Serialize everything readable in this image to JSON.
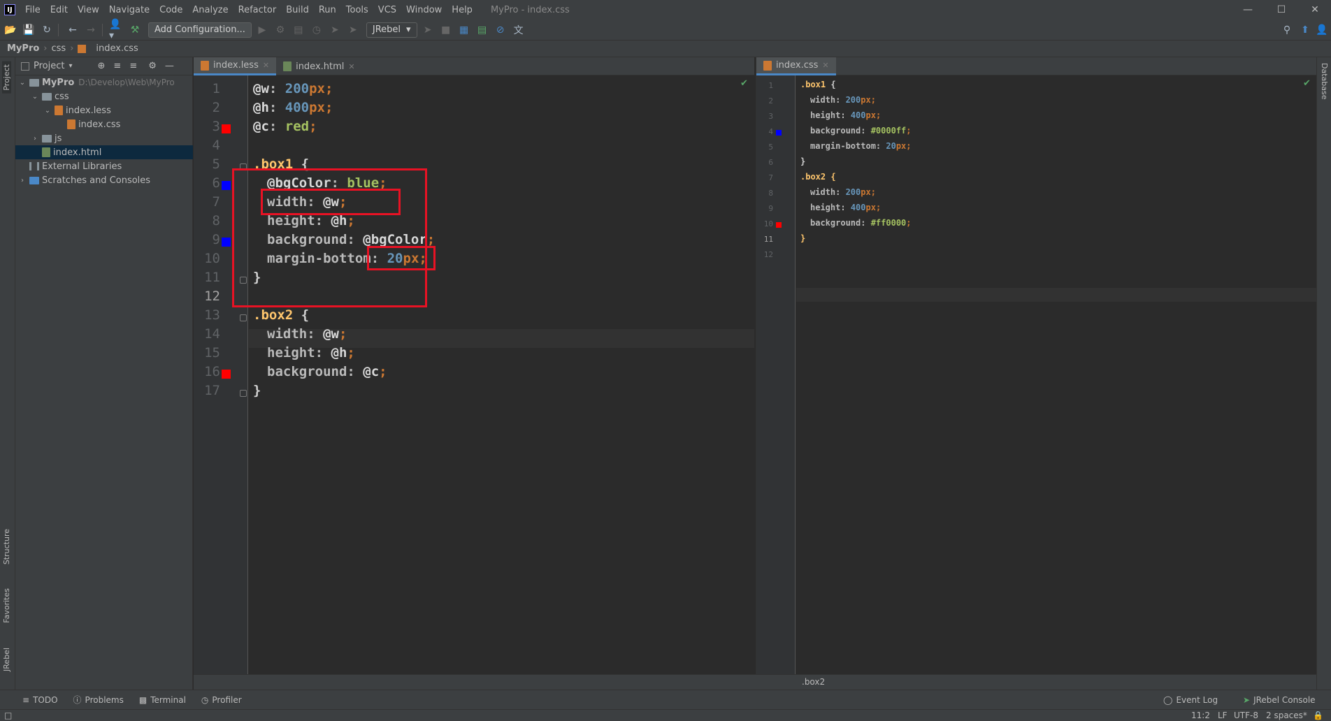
{
  "titlebar": {
    "menu": [
      "File",
      "Edit",
      "View",
      "Navigate",
      "Code",
      "Analyze",
      "Refactor",
      "Build",
      "Run",
      "Tools",
      "VCS",
      "Window",
      "Help"
    ],
    "title": "MyPro - index.css"
  },
  "toolbar": {
    "add_config_label": "Add Configuration...",
    "jrebel_label": "JRebel"
  },
  "breadcrumb": {
    "items": [
      "MyPro",
      "css",
      "index.css"
    ]
  },
  "project_panel": {
    "header": "Project",
    "tree": [
      {
        "label": "MyPro",
        "path": "D:\\Develop\\Web\\MyPro"
      },
      {
        "label": "css"
      },
      {
        "label": "index.less"
      },
      {
        "label": "index.css"
      },
      {
        "label": "js"
      },
      {
        "label": "index.html"
      },
      {
        "label": "External Libraries"
      },
      {
        "label": "Scratches and Consoles"
      }
    ]
  },
  "left_strip": {
    "tabs": [
      "Project",
      "Structure",
      "Favorites",
      "JRebel"
    ]
  },
  "right_strip": {
    "tabs": [
      "Database"
    ]
  },
  "editor_left": {
    "tabs": [
      "index.less",
      "index.html"
    ],
    "line_numbers": [
      "1",
      "2",
      "3",
      "4",
      "5",
      "6",
      "7",
      "8",
      "9",
      "10",
      "11",
      "12",
      "13",
      "14",
      "15",
      "16",
      "17"
    ],
    "swatch_colors": {
      "red": "#ff0000",
      "blue": "#0000ff"
    }
  },
  "editor_right": {
    "tabs": [
      "index.css"
    ],
    "line_numbers": [
      "1",
      "2",
      "3",
      "4",
      "5",
      "6",
      "7",
      "8",
      "9",
      "10",
      "11",
      "12"
    ]
  },
  "less_code": {
    "l1": {
      "var": "@w",
      "colon": ": ",
      "num": "200",
      "unit": "px",
      "semi": ";"
    },
    "l2": {
      "var": "@h",
      "colon": ": ",
      "num": "400",
      "unit": "px",
      "semi": ";"
    },
    "l3": {
      "var": "@c",
      "colon": ": ",
      "val": "red",
      "semi": ";"
    },
    "l5": {
      "sel": ".box1",
      "brace": " {"
    },
    "l6": {
      "var": "@bgColor",
      "colon": ": ",
      "val": "blue",
      "semi": ";"
    },
    "l7": {
      "prop": "width",
      "colon": ": ",
      "ref": "@w",
      "semi": ";"
    },
    "l8": {
      "prop": "height",
      "colon": ": ",
      "ref": "@h",
      "semi": ";"
    },
    "l9": {
      "prop": "background",
      "colon": ": ",
      "ref": "@bgColor",
      "semi": ";"
    },
    "l10": {
      "prop": "margin-bottom",
      "colon": ": ",
      "num": "20",
      "unit": "px",
      "semi": ";"
    },
    "l11": {
      "brace": "}"
    },
    "l13": {
      "sel": ".box2",
      "brace": " {"
    },
    "l14": {
      "prop": "width",
      "colon": ": ",
      "ref": "@w",
      "semi": ";"
    },
    "l15": {
      "prop": "height",
      "colon": ": ",
      "ref": "@h",
      "semi": ";"
    },
    "l16": {
      "prop": "background",
      "colon": ": ",
      "ref": "@c",
      "semi": ";"
    },
    "l17": {
      "brace": "}"
    }
  },
  "css_code": {
    "l1": {
      "sel": ".box1",
      "brace": " {"
    },
    "l2": {
      "prop": "width",
      "colon": ": ",
      "num": "200",
      "unit": "px",
      "semi": ";"
    },
    "l3": {
      "prop": "height",
      "colon": ": ",
      "num": "400",
      "unit": "px",
      "semi": ";"
    },
    "l4": {
      "prop": "background",
      "colon": ": ",
      "hex": "#0000ff",
      "semi": ";"
    },
    "l5": {
      "prop": "margin-bottom",
      "colon": ": ",
      "num": "20",
      "unit": "px",
      "semi": ";"
    },
    "l6": {
      "brace": "}"
    },
    "l7": {
      "sel": ".box2",
      "brace": " {"
    },
    "l8": {
      "prop": "width",
      "colon": ": ",
      "num": "200",
      "unit": "px",
      "semi": ";"
    },
    "l9": {
      "prop": "height",
      "colon": ": ",
      "num": "400",
      "unit": "px",
      "semi": ";"
    },
    "l10": {
      "prop": "background",
      "colon": ": ",
      "hex": "#ff0000",
      "semi": ";"
    },
    "l11": {
      "brace": "}"
    }
  },
  "crumb_bar": {
    "text": ".box2"
  },
  "bottom_tools": {
    "todo": "TODO",
    "problems": "Problems",
    "terminal": "Terminal",
    "profiler": "Profiler",
    "event_log": "Event Log",
    "jrebel_console": "JRebel Console"
  },
  "statusbar": {
    "position": "11:2",
    "line_sep": "LF",
    "encoding": "UTF-8",
    "indent": "2 spaces*"
  }
}
